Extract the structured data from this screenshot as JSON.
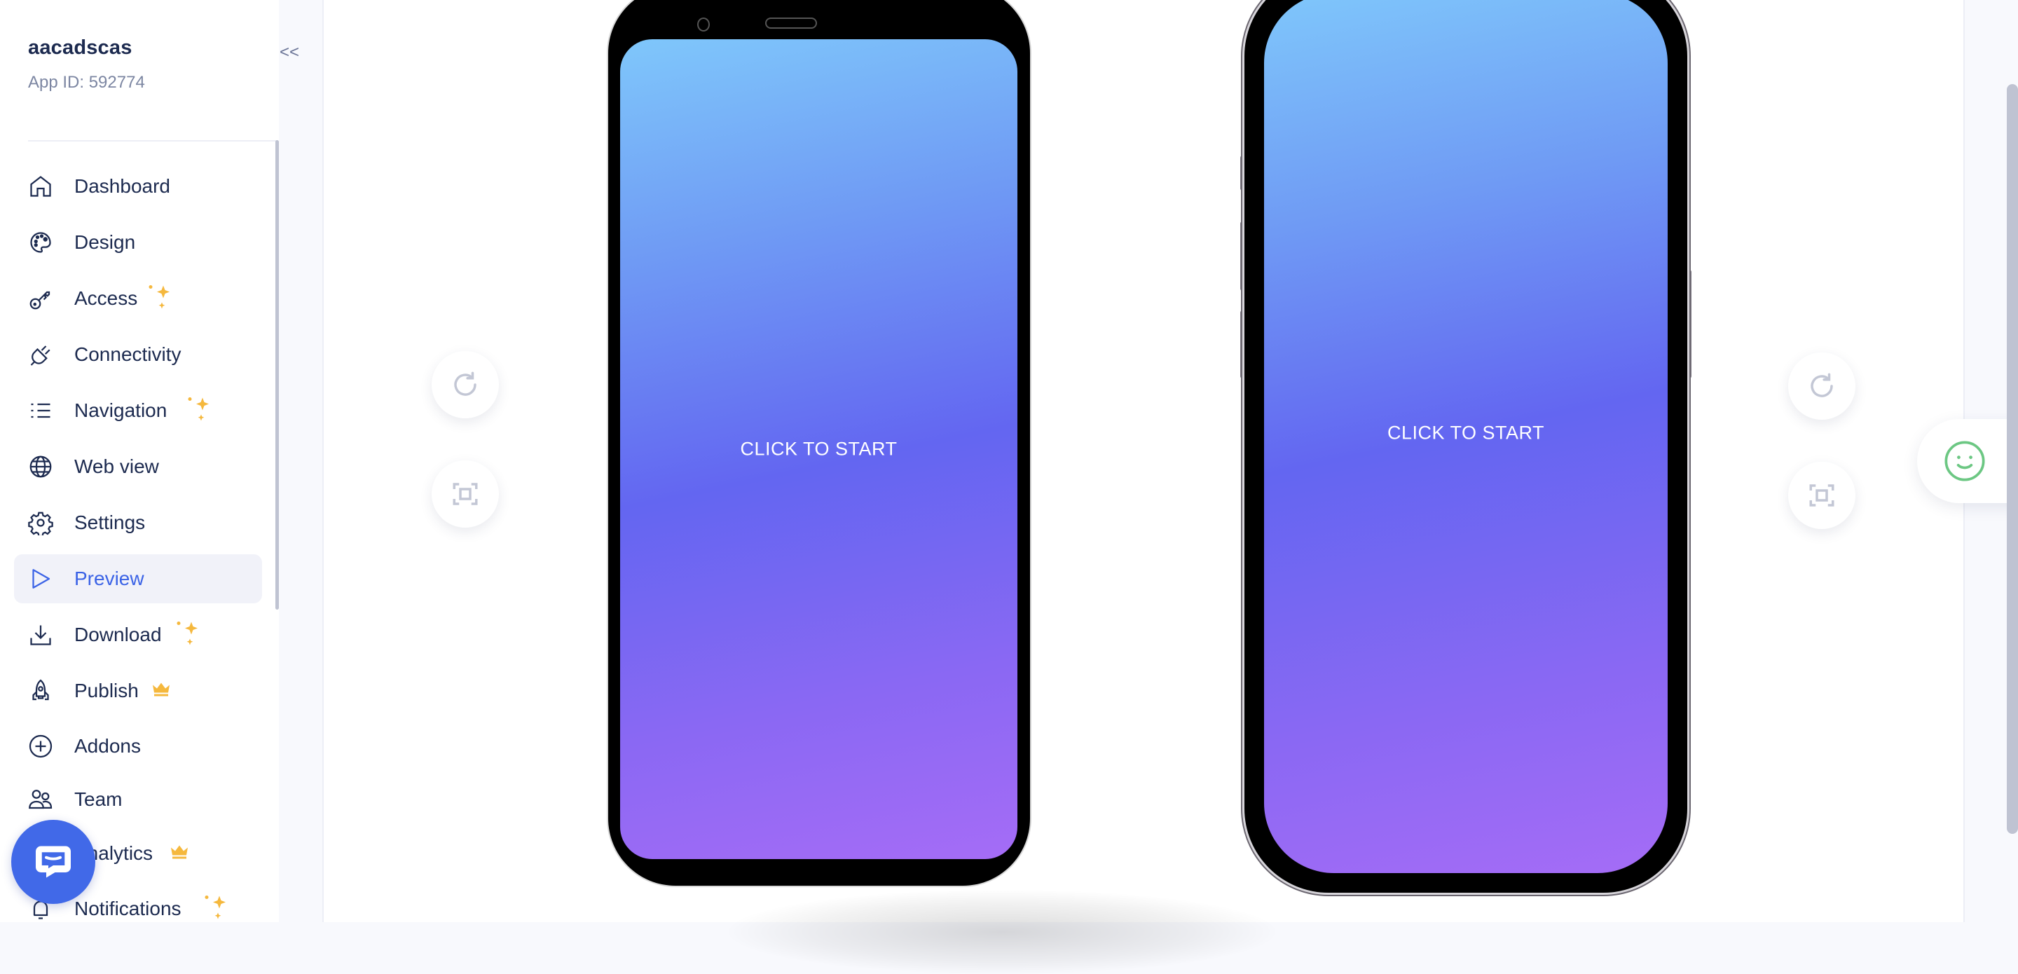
{
  "app": {
    "name": "aacadscas",
    "id_label": "App ID: 592774",
    "collapse_label": "<<"
  },
  "sidebar": {
    "items": [
      {
        "label": "Dashboard",
        "icon": "home-icon",
        "badge": null,
        "active": false
      },
      {
        "label": "Design",
        "icon": "palette-icon",
        "badge": null,
        "active": false
      },
      {
        "label": "Access",
        "icon": "key-icon",
        "badge": "sparkles",
        "active": false
      },
      {
        "label": "Connectivity",
        "icon": "plug-icon",
        "badge": null,
        "active": false
      },
      {
        "label": "Navigation",
        "icon": "list-icon",
        "badge": "sparkles",
        "active": false
      },
      {
        "label": "Web view",
        "icon": "globe-icon",
        "badge": null,
        "active": false
      },
      {
        "label": "Settings",
        "icon": "gear-icon",
        "badge": null,
        "active": false
      },
      {
        "label": "Preview",
        "icon": "play-icon",
        "badge": null,
        "active": true
      },
      {
        "label": "Download",
        "icon": "download-icon",
        "badge": "sparkles",
        "active": false
      },
      {
        "label": "Publish",
        "icon": "rocket-icon",
        "badge": "crown",
        "active": false
      },
      {
        "label": "Addons",
        "icon": "plus-circle-icon",
        "badge": null,
        "active": false
      },
      {
        "label": "Team",
        "icon": "users-icon",
        "badge": null,
        "active": false
      },
      {
        "label": "Analytics",
        "icon": "analytics-icon",
        "badge": "crown",
        "active": false
      },
      {
        "label": "Notifications",
        "icon": "bell-icon",
        "badge": "sparkles",
        "active": false
      }
    ]
  },
  "preview": {
    "android": {
      "cta": "CLICK TO START"
    },
    "iphone": {
      "cta": "CLICK TO START"
    },
    "left_controls": {
      "refresh": "refresh-icon",
      "screenshot": "screenshot-icon"
    },
    "right_controls": {
      "refresh": "refresh-icon",
      "screenshot": "screenshot-icon"
    }
  },
  "colors": {
    "accent": "#3b63e6",
    "text": "#1c2a4f",
    "muted": "#7c86a2",
    "sparkle": "#f5b83d",
    "gradient_top": "#7fc7fb",
    "gradient_mid": "#6366f1",
    "gradient_bottom": "#a56cf6",
    "feedback": "#6cc783",
    "chat": "#4169e8"
  }
}
